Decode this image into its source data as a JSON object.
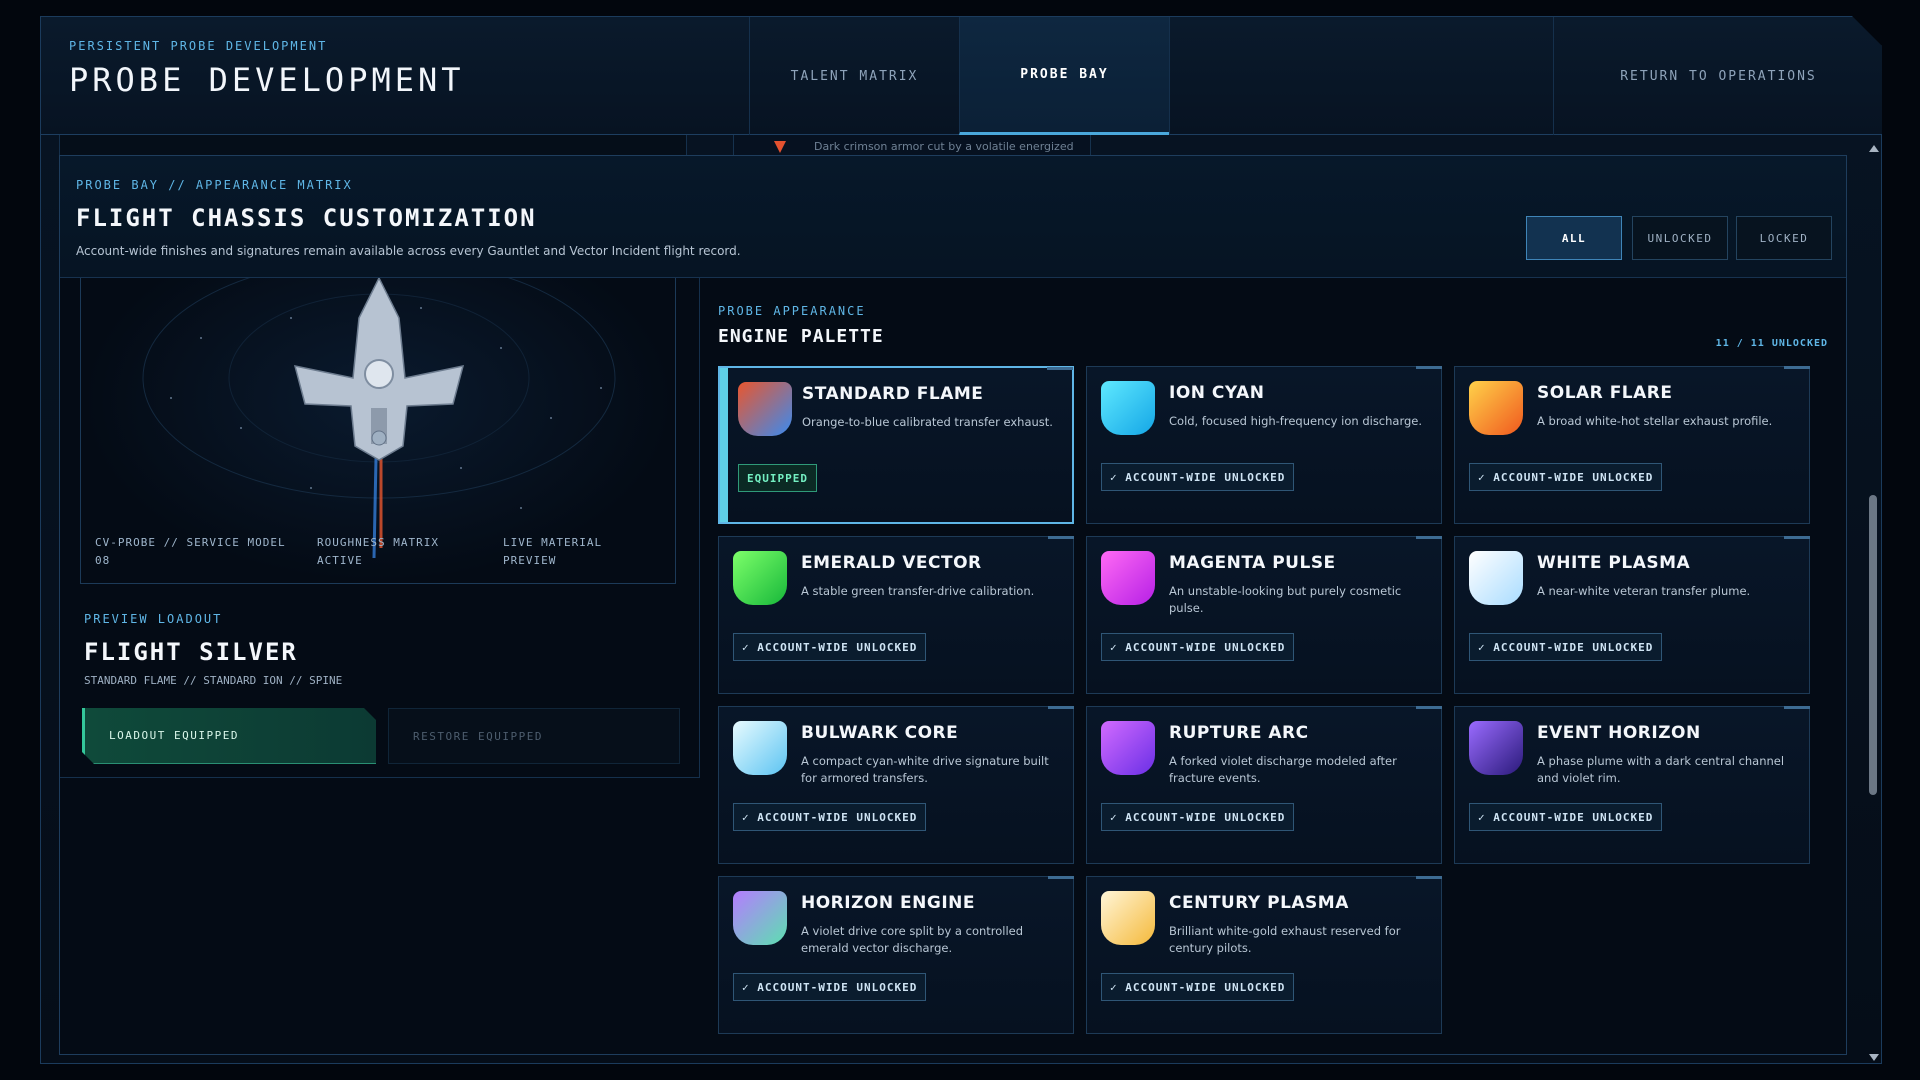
{
  "header": {
    "kicker": "PERSISTENT PROBE DEVELOPMENT",
    "title": "PROBE DEVELOPMENT",
    "tabs": [
      {
        "label": "TALENT MATRIX",
        "active": false
      },
      {
        "label": "PROBE BAY",
        "active": true
      }
    ],
    "return_label": "RETURN TO OPERATIONS"
  },
  "peek": {
    "text": "Dark crimson armor cut by a volatile energized warning stripe."
  },
  "card": {
    "kicker": "PROBE BAY // APPEARANCE MATRIX",
    "title": "FLIGHT CHASSIS CUSTOMIZATION",
    "description": "Account-wide finishes and signatures remain available across every Gauntlet and Vector Incident flight record.",
    "filters": [
      {
        "label": "ALL",
        "active": true
      },
      {
        "label": "UNLOCKED",
        "active": false
      },
      {
        "label": "LOCKED",
        "active": false
      }
    ]
  },
  "preview": {
    "labels": [
      "CV-PROBE // SERVICE MODEL 08",
      "ROUGHNESS MATRIX ACTIVE",
      "LIVE MATERIAL PREVIEW"
    ],
    "loadout_kicker": "PREVIEW LOADOUT",
    "loadout_title": "FLIGHT SILVER",
    "loadout_sub": "STANDARD FLAME // STANDARD ION // SPINE",
    "equipped_button": "LOADOUT EQUIPPED",
    "restore_button": "RESTORE EQUIPPED"
  },
  "palette": {
    "kicker": "PROBE APPEARANCE",
    "title": "ENGINE PALETTE",
    "count": "11 / 11 UNLOCKED",
    "items": [
      {
        "name": "STANDARD FLAME",
        "desc": "Orange-to-blue calibrated transfer exhaust.",
        "badge": "EQUIPPED",
        "equipped": true,
        "colors": [
          "#e9562e",
          "#3a8bf0"
        ]
      },
      {
        "name": "ION CYAN",
        "desc": "Cold, focused high-frequency ion discharge.",
        "badge": "✓ ACCOUNT-WIDE UNLOCKED",
        "equipped": false,
        "colors": [
          "#5fe9ff",
          "#14a6e6"
        ]
      },
      {
        "name": "SOLAR FLARE",
        "desc": "A broad white-hot stellar exhaust profile.",
        "badge": "✓ ACCOUNT-WIDE UNLOCKED",
        "equipped": false,
        "colors": [
          "#ffd24a",
          "#f0581e"
        ]
      },
      {
        "name": "EMERALD VECTOR",
        "desc": "A stable green transfer-drive calibration.",
        "badge": "✓ ACCOUNT-WIDE UNLOCKED",
        "equipped": false,
        "colors": [
          "#7dff6a",
          "#17b83a"
        ]
      },
      {
        "name": "MAGENTA PULSE",
        "desc": "An unstable-looking but purely cosmetic pulse.",
        "badge": "✓ ACCOUNT-WIDE UNLOCKED",
        "equipped": false,
        "colors": [
          "#ff6af4",
          "#b620e6"
        ]
      },
      {
        "name": "WHITE PLASMA",
        "desc": "A near-white veteran transfer plume.",
        "badge": "✓ ACCOUNT-WIDE UNLOCKED",
        "equipped": false,
        "colors": [
          "#ffffff",
          "#a9dcff"
        ]
      },
      {
        "name": "BULWARK CORE",
        "desc": "A compact cyan-white drive signature built for armored transfers.",
        "badge": "✓ ACCOUNT-WIDE UNLOCKED",
        "equipped": false,
        "colors": [
          "#e8fbff",
          "#5cc4f2"
        ]
      },
      {
        "name": "RUPTURE ARC",
        "desc": "A forked violet discharge modeled after fracture events.",
        "badge": "✓ ACCOUNT-WIDE UNLOCKED",
        "equipped": false,
        "colors": [
          "#d26bff",
          "#6a2fe6"
        ]
      },
      {
        "name": "EVENT HORIZON",
        "desc": "A phase plume with a dark central channel and violet rim.",
        "badge": "✓ ACCOUNT-WIDE UNLOCKED",
        "equipped": false,
        "colors": [
          "#9a6bff",
          "#2a1a7a"
        ]
      },
      {
        "name": "HORIZON ENGINE",
        "desc": "A violet drive core split by a controlled emerald vector discharge.",
        "badge": "✓ ACCOUNT-WIDE UNLOCKED",
        "equipped": false,
        "colors": [
          "#b57cff",
          "#5ce0b0"
        ]
      },
      {
        "name": "CENTURY PLASMA",
        "desc": "Brilliant white-gold exhaust reserved for century pilots.",
        "badge": "✓ ACCOUNT-WIDE UNLOCKED",
        "equipped": false,
        "colors": [
          "#fff6d8",
          "#f5b93a"
        ]
      }
    ]
  }
}
